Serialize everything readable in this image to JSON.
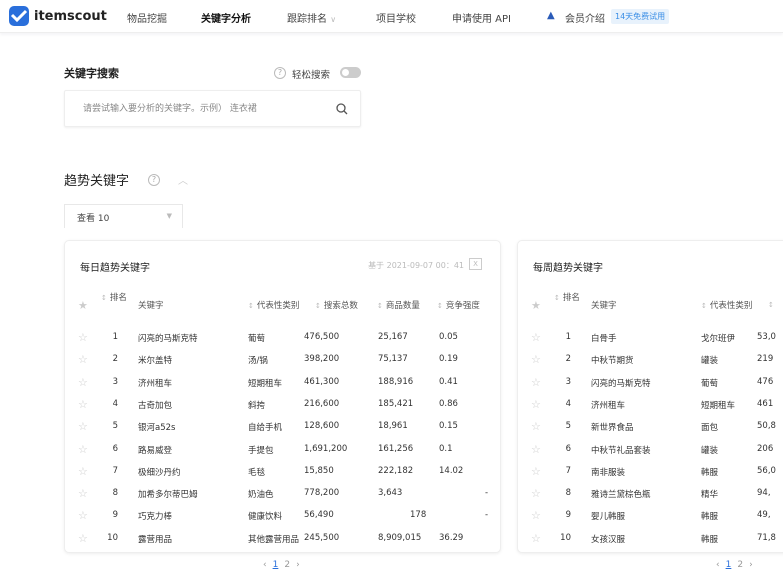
{
  "nav": {
    "brand": "itemscout",
    "items": [
      "物品挖掘",
      "关键字分析",
      "跟踪排名",
      "项目学校",
      "申请使用 API",
      "会员介绍"
    ],
    "trial_badge": "14天免费试用"
  },
  "search": {
    "title": "关键字搜索",
    "easy_search_label": "轻松搜索",
    "placeholder": "请尝试输入要分析的关键字。示例） 连衣裙"
  },
  "trend": {
    "title": "趋势关键字",
    "view_select": "查看 10"
  },
  "daily": {
    "title": "每日趋势关键字",
    "date": "基于 2021-09-07 00：41",
    "headers": [
      "排名",
      "关键字",
      "代表性类别",
      "搜索总数",
      "商品数量",
      "竞争强度"
    ],
    "rows": [
      [
        "1",
        "闪亮的马斯克特",
        "葡萄",
        "476,500",
        "25,167",
        "0.05"
      ],
      [
        "2",
        "米尔盖特",
        "汤/锅",
        "398,200",
        "75,137",
        "0.19"
      ],
      [
        "3",
        "济州租车",
        "短期租车",
        "461,300",
        "188,916",
        "0.41"
      ],
      [
        "4",
        "古奇加包",
        "斜挎",
        "216,600",
        "185,421",
        "0.86"
      ],
      [
        "5",
        "银河a52s",
        "自给手机",
        "128,600",
        "18,961",
        "0.15"
      ],
      [
        "6",
        "路易威登",
        "手提包",
        "1,691,200",
        "161,256",
        "0.1"
      ],
      [
        "7",
        "极细沙丹约",
        "毛毯",
        "15,850",
        "222,182",
        "14.02"
      ],
      [
        "8",
        "加希多尔蒂巴姆",
        "奶油色",
        "778,200",
        "3,643",
        "-"
      ],
      [
        "9",
        "巧克力棒",
        "健康饮料",
        "56,490",
        "178",
        "-"
      ],
      [
        "10",
        "露营用品",
        "其他露营用品",
        "245,500",
        "8,909,015",
        "36.29"
      ]
    ],
    "pages": [
      "1",
      "2"
    ]
  },
  "weekly": {
    "title": "每周趋势关键字",
    "headers": [
      "排名",
      "关键字",
      "代表性类别"
    ],
    "rows": [
      [
        "1",
        "白骨手",
        "戈尔班伊",
        "53,0"
      ],
      [
        "2",
        "中秋节期货",
        "罐装",
        "219"
      ],
      [
        "3",
        "闪亮的马斯克特",
        "葡萄",
        "476"
      ],
      [
        "4",
        "济州租车",
        "短期租车",
        "461"
      ],
      [
        "5",
        "新世界食品",
        "面包",
        "50,8"
      ],
      [
        "6",
        "中秋节礼品套装",
        "罐装",
        "206"
      ],
      [
        "7",
        "南非服装",
        "韩服",
        "56,0"
      ],
      [
        "8",
        "雅诗兰黛棕色瓶",
        "精华",
        "94,"
      ],
      [
        "9",
        "婴儿韩服",
        "韩服",
        "49,"
      ],
      [
        "10",
        "女孩汉服",
        "韩服",
        "71,8"
      ]
    ],
    "pages": [
      "1",
      "2"
    ]
  }
}
